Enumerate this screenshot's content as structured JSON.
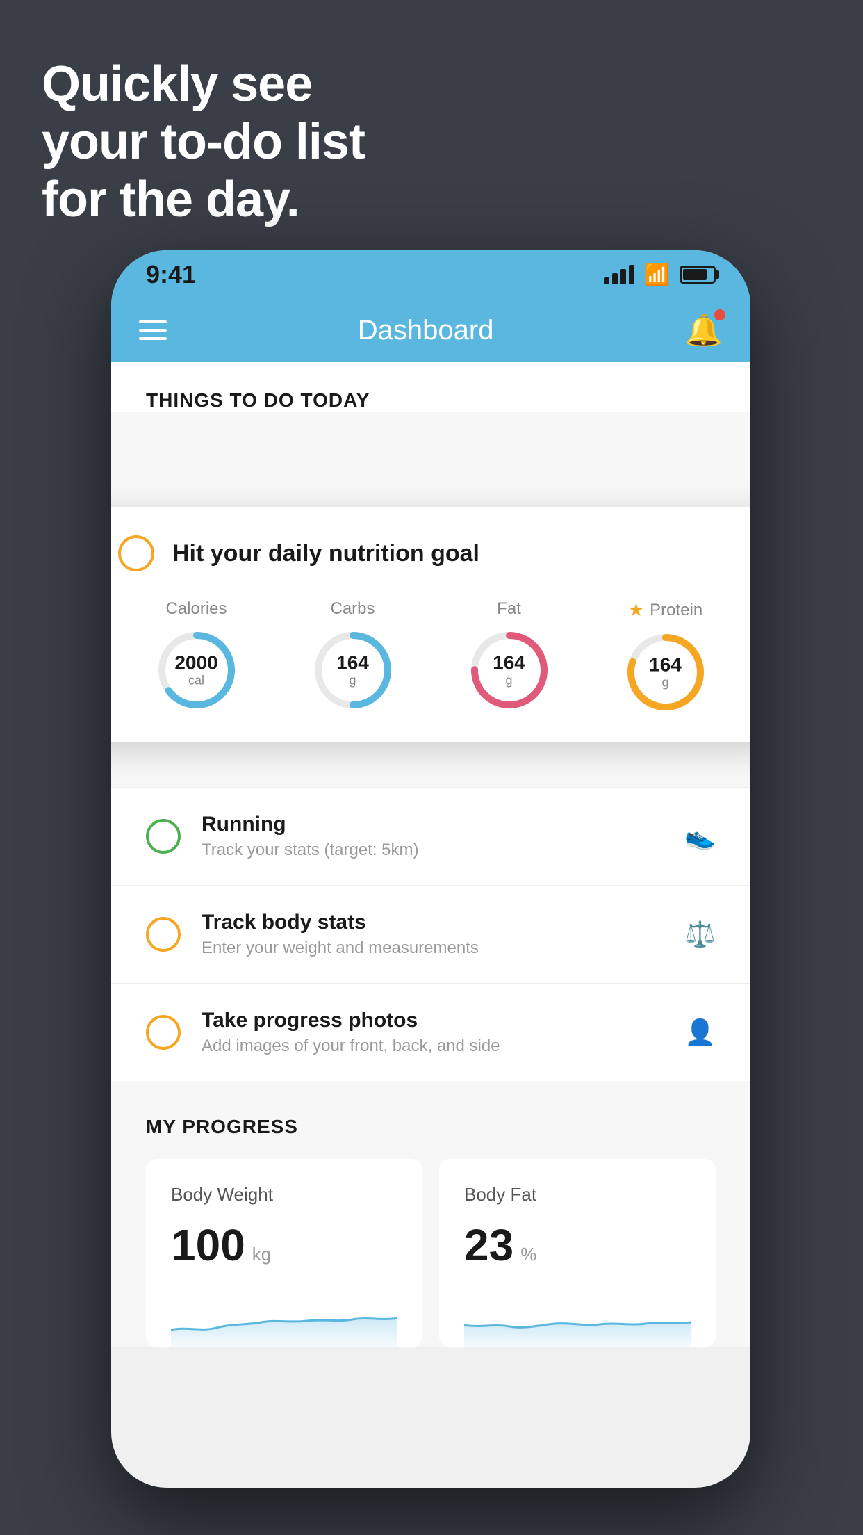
{
  "background_color": "#3a3f47",
  "headline": {
    "line1": "Quickly see",
    "line2": "your to-do list",
    "line3": "for the day."
  },
  "status_bar": {
    "time": "9:41"
  },
  "header": {
    "title": "Dashboard"
  },
  "todo_section": {
    "section_title": "THINGS TO DO TODAY"
  },
  "floating_card": {
    "circle_color": "#f5a623",
    "title": "Hit your daily nutrition goal",
    "nutrition_items": [
      {
        "label": "Calories",
        "value": "2000",
        "unit": "cal",
        "color": "#5ab8e0",
        "percent": 65
      },
      {
        "label": "Carbs",
        "value": "164",
        "unit": "g",
        "color": "#5ab8e0",
        "percent": 50
      },
      {
        "label": "Fat",
        "value": "164",
        "unit": "g",
        "color": "#e05a7a",
        "percent": 75
      },
      {
        "label": "Protein",
        "value": "164",
        "unit": "g",
        "color": "#f5a623",
        "percent": 80,
        "star": true
      }
    ]
  },
  "todo_items": [
    {
      "name": "Running",
      "subtitle": "Track your stats (target: 5km)",
      "circle_color": "green",
      "icon": "👟"
    },
    {
      "name": "Track body stats",
      "subtitle": "Enter your weight and measurements",
      "circle_color": "yellow",
      "icon": "⚖️"
    },
    {
      "name": "Take progress photos",
      "subtitle": "Add images of your front, back, and side",
      "circle_color": "yellow",
      "icon": "👤"
    }
  ],
  "progress_section": {
    "title": "MY PROGRESS",
    "cards": [
      {
        "title": "Body Weight",
        "value": "100",
        "unit": "kg"
      },
      {
        "title": "Body Fat",
        "value": "23",
        "unit": "%"
      }
    ]
  }
}
